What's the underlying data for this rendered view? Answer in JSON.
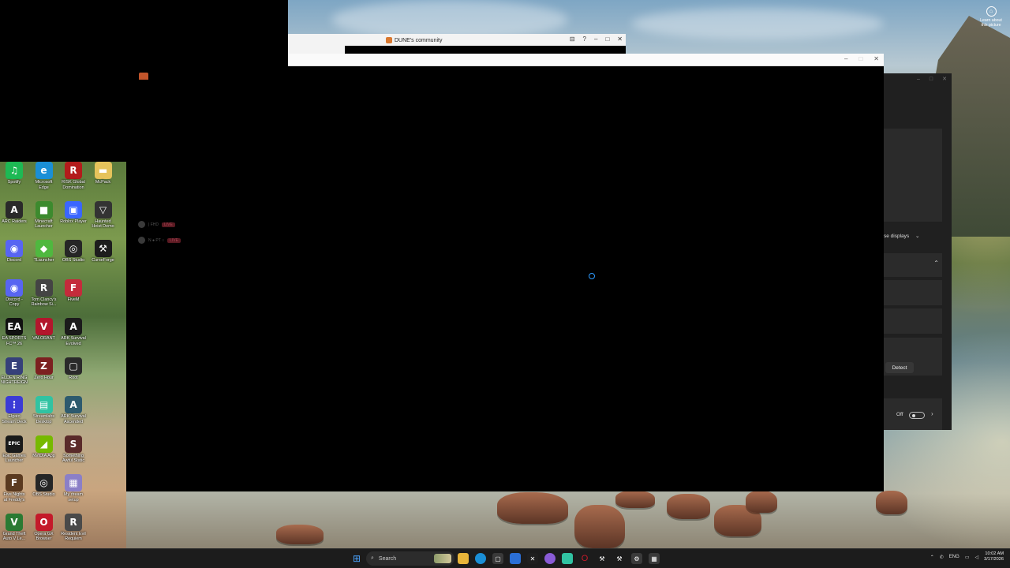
{
  "desktop": {
    "icons": [
      {
        "label": "Spotify",
        "color": "#1DB954",
        "glyph": "♫",
        "col": 0,
        "row": 0
      },
      {
        "label": "Microsoft\nEdge",
        "color": "#1a8fd6",
        "glyph": "e",
        "col": 1,
        "row": 0
      },
      {
        "label": "RISK Global\nDomination",
        "color": "#b31b1b",
        "glyph": "R",
        "col": 2,
        "row": 0
      },
      {
        "label": "McPack",
        "color": "#e5c35b",
        "glyph": "▬",
        "col": 3,
        "row": 0
      },
      {
        "label": "ARC Raiders",
        "color": "#2a2a2a",
        "glyph": "A",
        "col": 0,
        "row": 1
      },
      {
        "label": "Minecraft\nLauncher",
        "color": "#3c8a2e",
        "glyph": "■",
        "col": 1,
        "row": 1
      },
      {
        "label": "Roblox Player",
        "color": "#3a66ff",
        "glyph": "▣",
        "col": 2,
        "row": 1
      },
      {
        "label": "Haunted\nHeist Demo",
        "color": "#333",
        "glyph": "▽",
        "col": 3,
        "row": 1
      },
      {
        "label": "Discord",
        "color": "#5865F2",
        "glyph": "◉",
        "col": 0,
        "row": 2
      },
      {
        "label": "TLauncher",
        "color": "#4fb83f",
        "glyph": "◆",
        "col": 1,
        "row": 2
      },
      {
        "label": "OBS Studio",
        "color": "#262626",
        "glyph": "◎",
        "col": 2,
        "row": 2
      },
      {
        "label": "CurseForge",
        "color": "#1d1d1d",
        "glyph": "⚒",
        "col": 3,
        "row": 2
      },
      {
        "label": "Discord -\nCopy",
        "color": "#5865F2",
        "glyph": "◉",
        "col": 0,
        "row": 3
      },
      {
        "label": "Tom Clancy's\nRainbow Si...",
        "color": "#444",
        "glyph": "R",
        "col": 1,
        "row": 3
      },
      {
        "label": "FiveM",
        "color": "#c42b3b",
        "glyph": "F",
        "col": 2,
        "row": 3
      },
      {
        "label": "EA SPORTS\nFC™ 26",
        "color": "#111",
        "glyph": "EA",
        "col": 0,
        "row": 4
      },
      {
        "label": "VALORANT",
        "color": "#b3162c",
        "glyph": "V",
        "col": 1,
        "row": 4
      },
      {
        "label": "ARK Survival\nEvolved",
        "color": "#1b1b1b",
        "glyph": "A",
        "col": 2,
        "row": 4
      },
      {
        "label": "ELDEN RING\nNIGHTREIGN",
        "color": "#36407a",
        "glyph": "E",
        "col": 0,
        "row": 5
      },
      {
        "label": "Zero Hour",
        "color": "#7c2020",
        "glyph": "Z",
        "col": 1,
        "row": 5
      },
      {
        "label": "Root",
        "color": "#2a2a2a",
        "glyph": "▢",
        "col": 2,
        "row": 5
      },
      {
        "label": "Elgato\nStream Deck",
        "color": "#3b3bd6",
        "glyph": "⋮",
        "col": 0,
        "row": 6
      },
      {
        "label": "Streamlabs\nDesktop",
        "color": "#31c3a2",
        "glyph": "▤",
        "col": 1,
        "row": 6
      },
      {
        "label": "ARK Survival\nAscended",
        "color": "#2d5a6e",
        "glyph": "A",
        "col": 2,
        "row": 6
      },
      {
        "label": "Epic Games\nLauncher",
        "color": "#1a1a1a",
        "glyph": "EPIC",
        "col": 0,
        "row": 7
      },
      {
        "label": "NVIDIA App",
        "color": "#76b900",
        "glyph": "◢",
        "col": 1,
        "row": 7
      },
      {
        "label": "Something\nAwful Static",
        "color": "#5a2a2a",
        "glyph": "S",
        "col": 2,
        "row": 7
      },
      {
        "label": "Five Nights\nat Freddy's",
        "color": "#5b3a20",
        "glyph": "F",
        "col": 0,
        "row": 8
      },
      {
        "label": "OBS Studio",
        "color": "#262626",
        "glyph": "◎",
        "col": 1,
        "row": 8
      },
      {
        "label": "My dream\nsetup",
        "color": "#8b7fc7",
        "glyph": "▦",
        "col": 2,
        "row": 8
      },
      {
        "label": "Grand Theft\nAuto V Le...",
        "color": "#2a7a33",
        "glyph": "V",
        "col": 0,
        "row": 9
      },
      {
        "label": "Opera GX\nBrowser",
        "color": "#c41a2a",
        "glyph": "O",
        "col": 1,
        "row": 9
      },
      {
        "label": "Resident Evil\nRequiem",
        "color": "#4a4a4a",
        "glyph": "R",
        "col": 2,
        "row": 9
      }
    ],
    "learn_about_picture": "Learn about\nthis picture"
  },
  "dune_window": {
    "title": "DUNE's community",
    "controls": [
      "⊟",
      "?",
      "–",
      "□",
      "✕"
    ]
  },
  "main_window": {
    "controls": [
      "–",
      "□",
      "✕"
    ]
  },
  "faint_list": [
    {
      "text": "| FHD",
      "badge": "LIVE"
    },
    {
      "text": "N    ● PT   ○",
      "badge": "LIVE"
    }
  ],
  "settings_window": {
    "controls": [
      "–",
      "□",
      "✕"
    ],
    "displays_text": "se displays",
    "detect_label": "Detect",
    "toggle_label": "Off"
  },
  "taskbar": {
    "search_label": "Search",
    "tray": {
      "lang": "ENG",
      "time": "10:02 AM",
      "date": "3/17/2026"
    }
  }
}
